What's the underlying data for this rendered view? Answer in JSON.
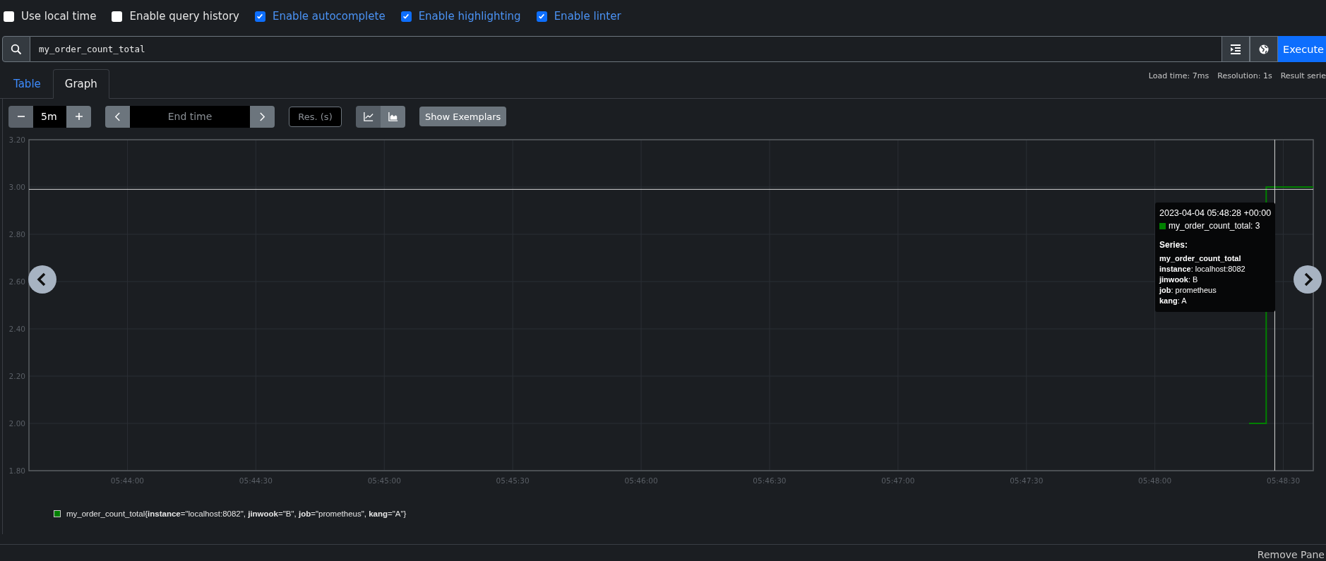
{
  "options": [
    {
      "label": "Use local time",
      "checked": false
    },
    {
      "label": "Enable query history",
      "checked": false
    },
    {
      "label": "Enable autocomplete",
      "checked": true
    },
    {
      "label": "Enable highlighting",
      "checked": true
    },
    {
      "label": "Enable linter",
      "checked": true
    }
  ],
  "query": {
    "value": "my_order_count_total",
    "execute_label": "Execute"
  },
  "tabs": [
    {
      "label": "Table",
      "selected": false
    },
    {
      "label": "Graph",
      "selected": true
    }
  ],
  "stats": [
    "Load time: 7ms",
    "Resolution: 1s",
    "Result serie"
  ],
  "toolbar": {
    "range": "5m",
    "end_time_placeholder": "End time",
    "resolution_placeholder": "Res. (s)",
    "chart_modes": [
      {
        "kind": "line",
        "selected": true
      },
      {
        "kind": "stacked",
        "selected": false
      }
    ],
    "exemplars_label": "Show Exemplars"
  },
  "graph": {
    "chart_data": {
      "type": "line",
      "grid": true,
      "ref_lines": [
        {
          "axis": "x",
          "value": 20908
        },
        {
          "axis": "y",
          "value": 2.99
        }
      ],
      "x": [
        20902,
        20906,
        20906,
        20917
      ],
      "series": [
        {
          "name": "my_order_count_total",
          "color": "#008000",
          "values": [
            2,
            2,
            3,
            3
          ]
        }
      ],
      "xlim": [
        20617,
        20917
      ],
      "ylim": [
        1.8,
        3.2
      ],
      "xticks": [
        {
          "value": 20640,
          "label": "05:44:00"
        },
        {
          "value": 20670,
          "label": "05:44:30"
        },
        {
          "value": 20700,
          "label": "05:45:00"
        },
        {
          "value": 20730,
          "label": "05:45:30"
        },
        {
          "value": 20760,
          "label": "05:46:00"
        },
        {
          "value": 20790,
          "label": "05:46:30"
        },
        {
          "value": 20820,
          "label": "05:47:00"
        },
        {
          "value": 20850,
          "label": "05:47:30"
        },
        {
          "value": 20880,
          "label": "05:48:00"
        },
        {
          "value": 20910,
          "label": "05:48:30"
        }
      ],
      "yticks": [
        {
          "value": 1.8,
          "label": "1.80"
        },
        {
          "value": 2.0,
          "label": "2.00"
        },
        {
          "value": 2.2,
          "label": "2.20"
        },
        {
          "value": 2.4,
          "label": "2.40"
        },
        {
          "value": 2.6,
          "label": "2.60"
        },
        {
          "value": 2.8,
          "label": "2.80"
        },
        {
          "value": 3.0,
          "label": "3.00"
        },
        {
          "value": 3.2,
          "label": "3.20"
        }
      ]
    },
    "tooltip": {
      "time": "2023-04-04 05:48:28 +00:00",
      "value_line": "my_order_count_total: 3",
      "heading": "Series:",
      "lines": [
        "my_order_count_total",
        "**instance**: localhost:8082",
        "**jinwook**: B",
        "**job**: prometheus",
        "**kang**: A"
      ]
    },
    "legend_labels": "{**instance**=\"localhost:8082\", **jinwook**=\"B\", **job**=\"prometheus\", **kang**=\"A\"}"
  },
  "remove_label": "Remove Pane"
}
